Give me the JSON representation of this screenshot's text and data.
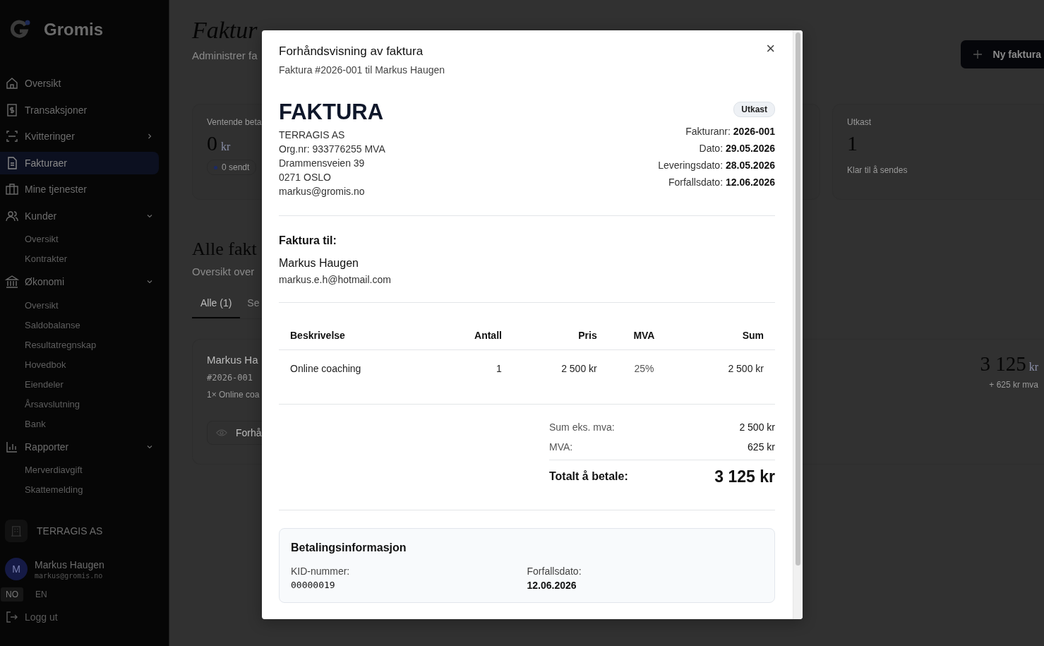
{
  "sidebar": {
    "brand": "Gromis",
    "items": [
      {
        "label": "Oversikt",
        "selected": false
      },
      {
        "label": "Transaksjoner",
        "selected": false
      },
      {
        "label": "Kvitteringer",
        "selected": false,
        "expanded": false
      },
      {
        "label": "Fakturaer",
        "selected": true
      },
      {
        "label": "Mine tjenester",
        "selected": false
      },
      {
        "label": "Kunder",
        "selected": false,
        "expanded": true,
        "children": [
          {
            "label": "Oversikt"
          },
          {
            "label": "Kontrakter"
          }
        ]
      },
      {
        "label": "Økonomi",
        "selected": false,
        "expanded": true,
        "children": [
          {
            "label": "Oversikt"
          },
          {
            "label": "Saldobalanse"
          },
          {
            "label": "Resultatregnskap"
          },
          {
            "label": "Hovedbok"
          },
          {
            "label": "Eiendeler"
          },
          {
            "label": "Årsavslutning"
          },
          {
            "label": "Bank"
          }
        ]
      },
      {
        "label": "Rapporter",
        "selected": false,
        "expanded": true,
        "children": [
          {
            "label": "Merverdiavgift"
          },
          {
            "label": "Skattemelding"
          }
        ]
      }
    ],
    "company": "TERRAGIS AS",
    "user": {
      "initial": "M",
      "name": "Markus Haugen",
      "email": "markus@gromis.no"
    },
    "languages": [
      {
        "label": "NO",
        "selected": true
      },
      {
        "label": "EN",
        "selected": false
      }
    ],
    "logout": "Logg ut"
  },
  "page": {
    "title": "Faktur",
    "subtitle": "Administrer fa",
    "new_button": "Ny faktura",
    "stats": [
      {
        "label": "Ventende beta",
        "value": "0",
        "unit": "kr",
        "pill": "0 sendt"
      },
      {
        "label": "Utkast",
        "value": "1",
        "note": "Klar til å sendes"
      }
    ],
    "section_title": "Alle fakt",
    "section_subtitle": "Oversikt over",
    "tabs": [
      {
        "label": "Alle (1)",
        "selected": true
      },
      {
        "label": "Se",
        "selected": false
      }
    ],
    "invoice": {
      "customer": "Markus Ha",
      "number": "#2026-001",
      "line": "1× Online coa",
      "preview_button": "Forhå",
      "amount": "3 125",
      "unit": "kr",
      "vat": "+ 625 kr mva"
    }
  },
  "modal": {
    "title": "Forhåndsvisning av faktura",
    "subtitle": "Faktura #2026-001 til Markus Haugen",
    "close": "×",
    "heading": "FAKTURA",
    "status": "Utkast",
    "sender": [
      "TERRAGIS AS",
      "Org.nr: 933776255 MVA",
      "Drammensveien 39",
      "0271 OSLO",
      "markus@gromis.no"
    ],
    "meta": [
      "Fakturanr: **2026-001**",
      "Dato: **29.05.2026**",
      "Leveringsdato: **28.05.2026**",
      "Forfallsdato: **12.06.2026**"
    ],
    "to_label": "Faktura til:",
    "to_name": "Markus Haugen",
    "to_email": "markus.e.h@hotmail.com",
    "table": {
      "columns": [
        "Beskrivelse",
        "Antall",
        "Pris",
        "MVA",
        "Sum"
      ],
      "rows": [
        [
          "Online coaching",
          "1",
          "2 500 kr",
          "25%",
          "2 500 kr"
        ]
      ]
    },
    "totals": [
      {
        "label": "Sum eks. mva:",
        "value": "2 500 kr"
      },
      {
        "label": "MVA:",
        "value": "625 kr"
      }
    ],
    "grand_total": {
      "label": "Totalt å betale:",
      "value": "3 125 kr"
    },
    "payment": {
      "title": "Betalingsinformasjon",
      "fields": [
        {
          "label": "KID-nummer:",
          "value": "00000019",
          "kind": "mono"
        },
        {
          "label": "Forfallsdato:",
          "value": "12.06.2026",
          "kind": "text"
        }
      ]
    }
  }
}
